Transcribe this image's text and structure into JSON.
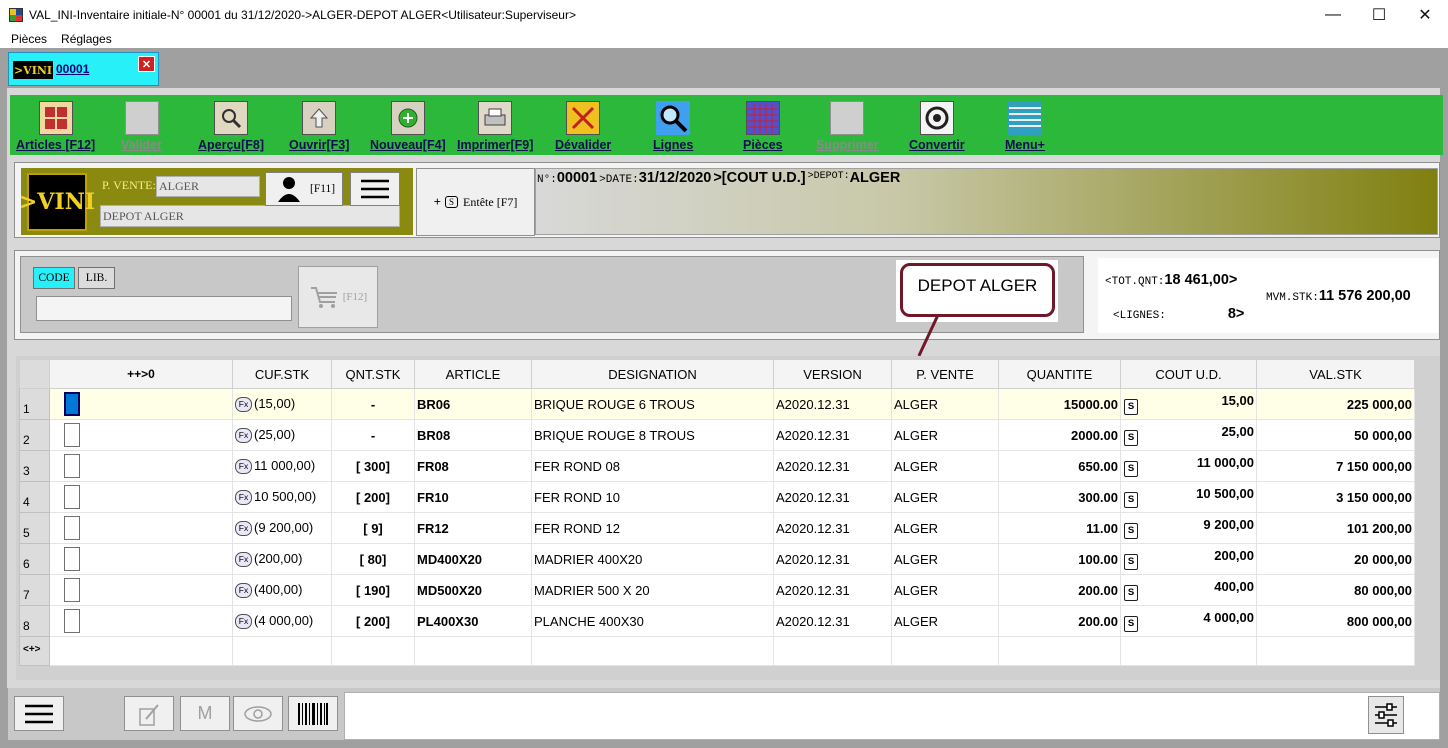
{
  "window": {
    "title": "VAL_INI-Inventaire initiale-N° 00001 du 31/12/2020->ALGER-DEPOT ALGER<Utilisateur:Superviseur>",
    "minimize": "—",
    "maximize": "☐",
    "close": "✕"
  },
  "menu": {
    "items": [
      "Pièces",
      "Réglages"
    ]
  },
  "doc_tab": {
    "logo": ">VINI",
    "number": "00001",
    "close": "✕"
  },
  "toolbar": {
    "items": [
      {
        "label": "Articles [F12]",
        "icon": "articles-icon",
        "enabled": true
      },
      {
        "label": "Valider",
        "icon": "valider-icon",
        "enabled": false
      },
      {
        "label": "Aperçu[F8]",
        "icon": "preview-icon",
        "enabled": true
      },
      {
        "label": "Ouvrir[F3]",
        "icon": "open-icon",
        "enabled": true
      },
      {
        "label": "Nouveau[F4]",
        "icon": "new-icon",
        "enabled": true
      },
      {
        "label": "Imprimer[F9]",
        "icon": "print-icon",
        "enabled": true
      },
      {
        "label": "Dévalider",
        "icon": "unvalidate-icon",
        "enabled": true
      },
      {
        "label": "Lignes",
        "icon": "search-icon",
        "enabled": true
      },
      {
        "label": "Pièces",
        "icon": "grid-icon",
        "enabled": true
      },
      {
        "label": "Supprimer",
        "icon": "delete-icon",
        "enabled": false
      },
      {
        "label": "Convertir",
        "icon": "convert-icon",
        "enabled": true
      },
      {
        "label": "Menu+",
        "icon": "menu-lines-icon",
        "enabled": true
      }
    ]
  },
  "header": {
    "logo": ">VINI",
    "pv_label": "P. VENTE:",
    "pv_value": "ALGER",
    "depot_value": "DEPOT ALGER",
    "user_key": "[F11]",
    "entete_label": "Entête [F7]",
    "plus": "+",
    "s": "S",
    "info": {
      "num_label": "N°:",
      "num_value": "00001",
      "date_label": ">DATE:",
      "date_value": "31/12/2020",
      "cout_value": ">[COUT U.D.]",
      "depot_label": ">DEPOT:",
      "depot_value": "ALGER"
    }
  },
  "search": {
    "code_label": "CODE",
    "lib_label": "LIB.",
    "cart_key": "[F12]",
    "value": ""
  },
  "callout": {
    "text": "DEPOT ALGER"
  },
  "totals": {
    "tot_qnt_label": "<TOT.QNT:",
    "tot_qnt_value": "18 461,00>",
    "lignes_label": "<LIGNES:",
    "lignes_value": "8>",
    "mvm_stk_label": "MVM.STK:",
    "mvm_stk_value": "11 576 200,00"
  },
  "grid": {
    "columns": [
      "++>0",
      "CUF.STK",
      "QNT.STK",
      "ARTICLE",
      "DESIGNATION",
      "VERSION",
      "P. VENTE",
      "QUANTITE",
      "COUT U.D.",
      "VAL.STK"
    ],
    "rows": [
      {
        "n": "1",
        "cuf": "(15,00)",
        "qnt": "-",
        "article": "BR06",
        "designation": "BRIQUE ROUGE 6 TROUS",
        "version": "A2020.12.31",
        "pvente": "ALGER",
        "quantite": "15000.00",
        "cout": "15,00",
        "val": "225 000,00"
      },
      {
        "n": "2",
        "cuf": "(25,00)",
        "qnt": "-",
        "article": "BR08",
        "designation": "BRIQUE ROUGE 8 TROUS",
        "version": "A2020.12.31",
        "pvente": "ALGER",
        "quantite": "2000.00",
        "cout": "25,00",
        "val": "50 000,00"
      },
      {
        "n": "3",
        "cuf": "11 000,00)",
        "qnt": "[ 300]",
        "article": "FR08",
        "designation": "FER ROND 08",
        "version": "A2020.12.31",
        "pvente": "ALGER",
        "quantite": "650.00",
        "cout": "11 000,00",
        "val": "7 150 000,00"
      },
      {
        "n": "4",
        "cuf": "10 500,00)",
        "qnt": "[ 200]",
        "article": "FR10",
        "designation": "FER ROND 10",
        "version": "A2020.12.31",
        "pvente": "ALGER",
        "quantite": "300.00",
        "cout": "10 500,00",
        "val": "3 150 000,00"
      },
      {
        "n": "5",
        "cuf": "(9 200,00)",
        "qnt": "[ 9]",
        "article": "FR12",
        "designation": "FER ROND 12",
        "version": "A2020.12.31",
        "pvente": "ALGER",
        "quantite": "11.00",
        "cout": "9 200,00",
        "val": "101 200,00"
      },
      {
        "n": "6",
        "cuf": "(200,00)",
        "qnt": "[ 80]",
        "article": "MD400X20",
        "designation": "MADRIER 400X20",
        "version": "A2020.12.31",
        "pvente": "ALGER",
        "quantite": "100.00",
        "cout": "200,00",
        "val": "20 000,00"
      },
      {
        "n": "7",
        "cuf": "(400,00)",
        "qnt": "[ 190]",
        "article": "MD500X20",
        "designation": "MADRIER 500 X 20",
        "version": "A2020.12.31",
        "pvente": "ALGER",
        "quantite": "200.00",
        "cout": "400,00",
        "val": "80 000,00"
      },
      {
        "n": "8",
        "cuf": "(4 000,00)",
        "qnt": "[ 200]",
        "article": "PL400X30",
        "designation": "PLANCHE 400X30",
        "version": "A2020.12.31",
        "pvente": "ALGER",
        "quantite": "200.00",
        "cout": "4 000,00",
        "val": "800 000,00"
      }
    ],
    "footer_label": "<+>",
    "fx_label": "Fx",
    "s_label": "S"
  },
  "bottom": {
    "m_label": "M"
  }
}
